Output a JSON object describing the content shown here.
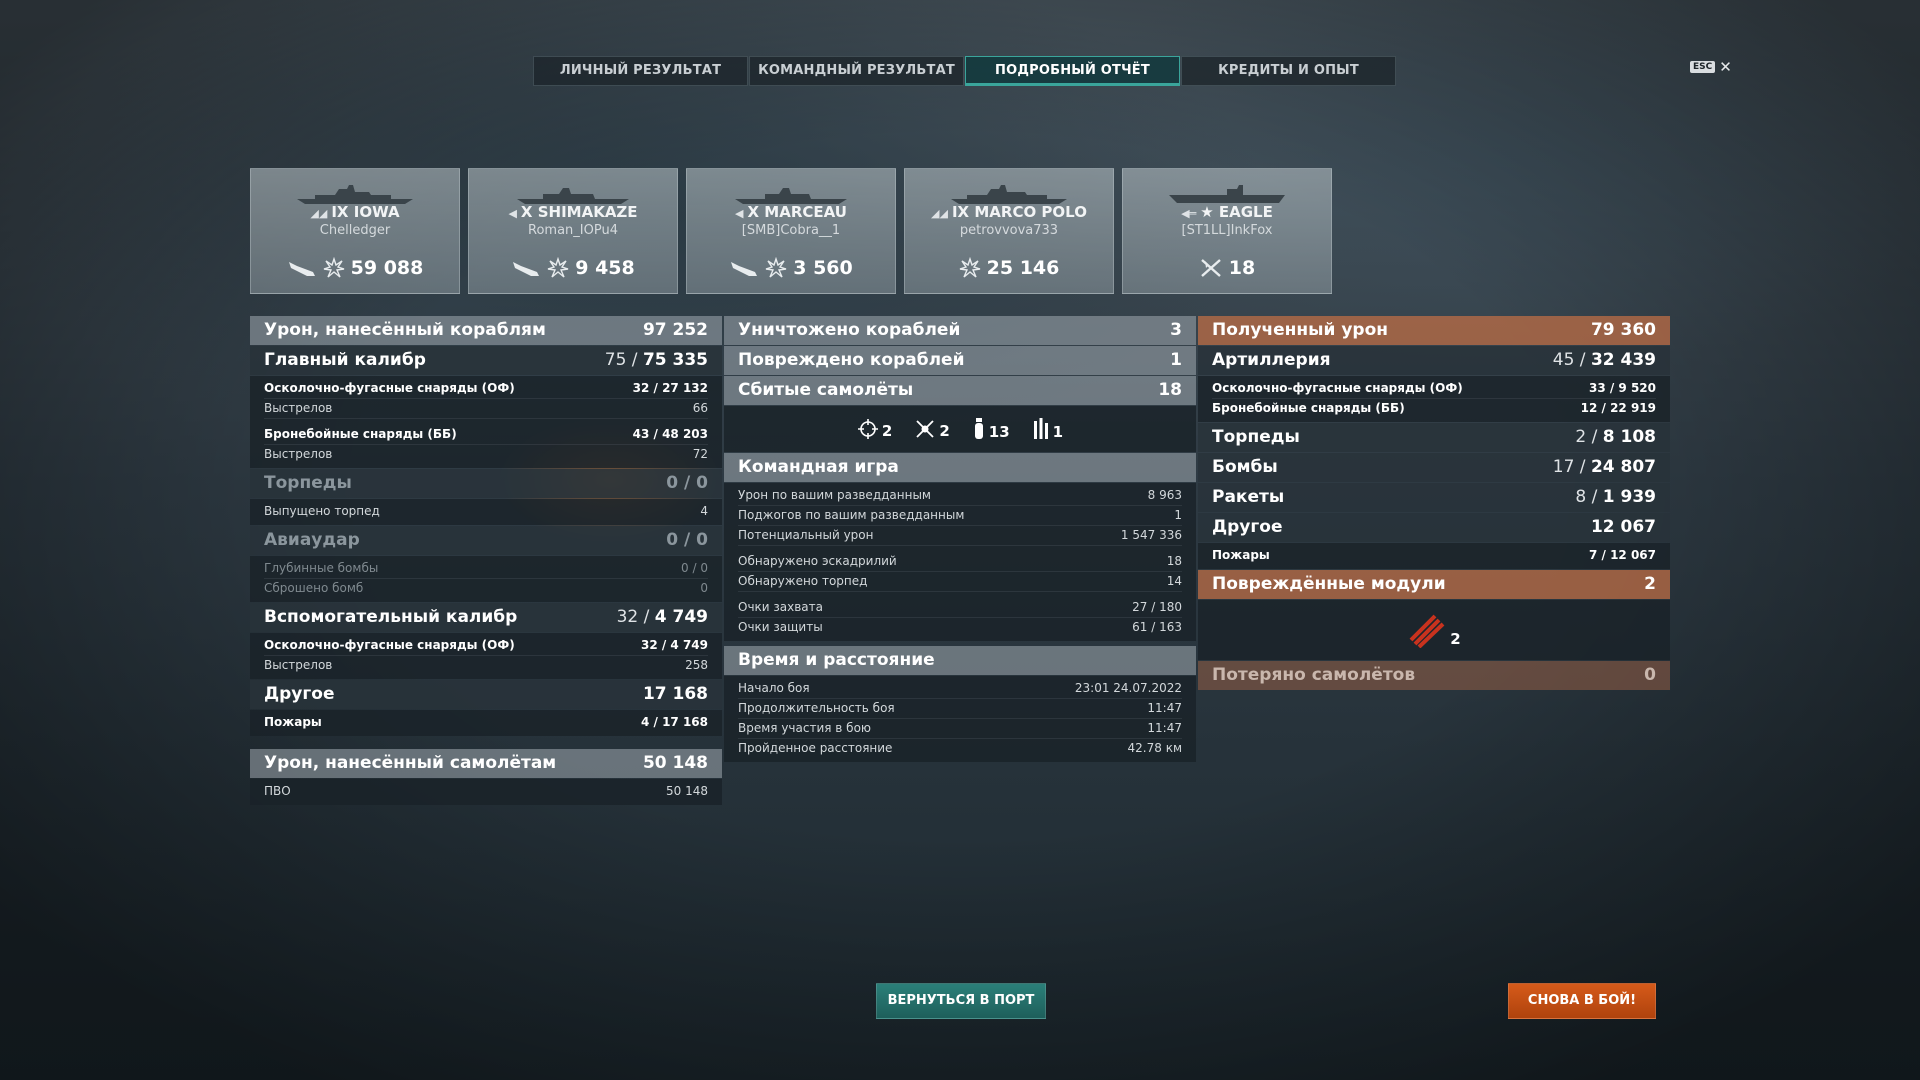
{
  "tabs": [
    {
      "label": "ЛИЧНЫЙ РЕЗУЛЬТАТ"
    },
    {
      "label": "КОМАНДНЫЙ РЕЗУЛЬТАТ"
    },
    {
      "label": "ПОДРОБНЫЙ ОТЧЁТ"
    },
    {
      "label": "КРЕДИТЫ И ОПЫТ"
    }
  ],
  "active_tab": "ПОДРОБНЫЙ ОТЧЁТ",
  "close": {
    "key": "ESC",
    "icon": "close-icon"
  },
  "ships": [
    {
      "tier": "IX",
      "name": "IOWA",
      "player": "Chelledger",
      "value": "59 088",
      "icons": [
        "torpedo-icon",
        "damage-icon"
      ]
    },
    {
      "tier": "X",
      "name": "SHIMAKAZE",
      "player": "Roman_IOPu4",
      "value": "9 458",
      "icons": [
        "torpedo-icon",
        "damage-icon"
      ]
    },
    {
      "tier": "X",
      "name": "MARCEAU",
      "player": "[SMB]Cobra__1",
      "value": "3 560",
      "icons": [
        "torpedo-icon",
        "damage-icon"
      ]
    },
    {
      "tier": "IX",
      "name": "MARCO POLO",
      "player": "petrovvova733",
      "value": "25 146",
      "icons": [
        "damage-icon"
      ]
    },
    {
      "tier": "★",
      "name": "EAGLE",
      "player": "[ST1LL]InkFox",
      "value": "18",
      "icons": [
        "plane-shot-icon"
      ]
    }
  ],
  "left": {
    "ship_damage": {
      "label": "Урон, нанесённый кораблям",
      "value": "97 252"
    },
    "main_battery": {
      "label": "Главный калибр",
      "hits": "75",
      "total": "75 335"
    },
    "main_rows": [
      {
        "label": "Осколочно-фугасные снаряды (ОФ)",
        "hits": "32",
        "total": "27 132"
      },
      {
        "label": "Выстрелов",
        "value": "66"
      },
      {
        "label": "Бронебойные снаряды (ББ)",
        "hits": "43",
        "total": "48 203"
      },
      {
        "label": "Выстрелов",
        "value": "72"
      }
    ],
    "torpedoes": {
      "label": "Торпеды",
      "hits": "0",
      "total": "0"
    },
    "torpedo_rows": [
      {
        "label": "Выпущено торпед",
        "value": "4"
      }
    ],
    "airstrike": {
      "label": "Авиаудар",
      "hits": "0",
      "total": "0"
    },
    "airstrike_rows": [
      {
        "label": "Глубинные бомбы",
        "value": "0 / 0"
      },
      {
        "label": "Сброшено бомб",
        "value": "0"
      }
    ],
    "secondary": {
      "label": "Вспомогательный калибр",
      "hits": "32",
      "total": "4 749"
    },
    "secondary_rows": [
      {
        "label": "Осколочно-фугасные снаряды (ОФ)",
        "hits": "32",
        "total": "4 749"
      },
      {
        "label": "Выстрелов",
        "value": "258"
      }
    ],
    "other": {
      "label": "Другое",
      "value": "17 168"
    },
    "other_rows": [
      {
        "label": "Пожары",
        "hits": "4",
        "total": "17 168"
      }
    ],
    "plane_damage": {
      "label": "Урон, нанесённый самолётам",
      "value": "50 148"
    },
    "plane_rows": [
      {
        "label": "ПВО",
        "value": "50 148"
      }
    ]
  },
  "middle": {
    "destroyed": {
      "label": "Уничтожено кораблей",
      "value": "3"
    },
    "damaged": {
      "label": "Повреждено кораблей",
      "value": "1"
    },
    "planes": {
      "label": "Сбитые самолёты",
      "value": "18"
    },
    "plane_icons": [
      {
        "icon": "crosshair-icon",
        "value": "2"
      },
      {
        "icon": "fighter-icon",
        "value": "2"
      },
      {
        "icon": "bomb-icon",
        "value": "13"
      },
      {
        "icon": "rocket-icon",
        "value": "1"
      }
    ],
    "teamplay": {
      "label": "Командная игра"
    },
    "teamplay_rows_a": [
      {
        "label": "Урон по вашим разведданным",
        "value": "8 963"
      },
      {
        "label": "Поджогов по вашим разведданным",
        "value": "1"
      },
      {
        "label": "Потенциальный урон",
        "value": "1 547 336"
      }
    ],
    "teamplay_rows_b": [
      {
        "label": "Обнаружено эскадрилий",
        "value": "18"
      },
      {
        "label": "Обнаружено торпед",
        "value": "14"
      }
    ],
    "teamplay_rows_c": [
      {
        "label": "Очки захвата",
        "value": "27 / 180"
      },
      {
        "label": "Очки защиты",
        "value": "61 / 163"
      }
    ],
    "time": {
      "label": "Время и расстояние"
    },
    "time_rows": [
      {
        "label": "Начало боя",
        "value": "23:01  24.07.2022"
      },
      {
        "label": "Продолжительность боя",
        "value": "11:47"
      },
      {
        "label": "Время участия в бою",
        "value": "11:47"
      },
      {
        "label": "Пройденное расстояние",
        "value": "42.78 км"
      }
    ]
  },
  "right": {
    "received": {
      "label": "Полученный урон",
      "value": "79 360"
    },
    "artillery": {
      "label": "Артиллерия",
      "hits": "45",
      "total": "32 439"
    },
    "artillery_rows": [
      {
        "label": "Осколочно-фугасные снаряды (ОФ)",
        "hits": "33",
        "total": "9 520"
      },
      {
        "label": "Бронебойные снаряды (ББ)",
        "hits": "12",
        "total": "22 919"
      }
    ],
    "torpedoes": {
      "label": "Торпеды",
      "hits": "2",
      "total": "8 108"
    },
    "bombs": {
      "label": "Бомбы",
      "hits": "17",
      "total": "24 807"
    },
    "rockets": {
      "label": "Ракеты",
      "hits": "8",
      "total": "1 939"
    },
    "other": {
      "label": "Другое",
      "value": "12 067"
    },
    "other_rows": [
      {
        "label": "Пожары",
        "hits": "7",
        "total": "12 067"
      }
    ],
    "modules": {
      "label": "Повреждённые модули",
      "value": "2"
    },
    "module_icon": {
      "icon": "damaged-module-icon",
      "value": "2"
    },
    "planes_lost": {
      "label": "Потеряно самолётов",
      "value": "0"
    }
  },
  "buttons": {
    "port": "ВЕРНУТЬСЯ В ПОРТ",
    "battle": "СНОВА В БОЙ!"
  },
  "colors": {
    "accent_teal": "#2b7f79",
    "accent_orange": "#d55a1a",
    "received_header": "#be6e46"
  }
}
